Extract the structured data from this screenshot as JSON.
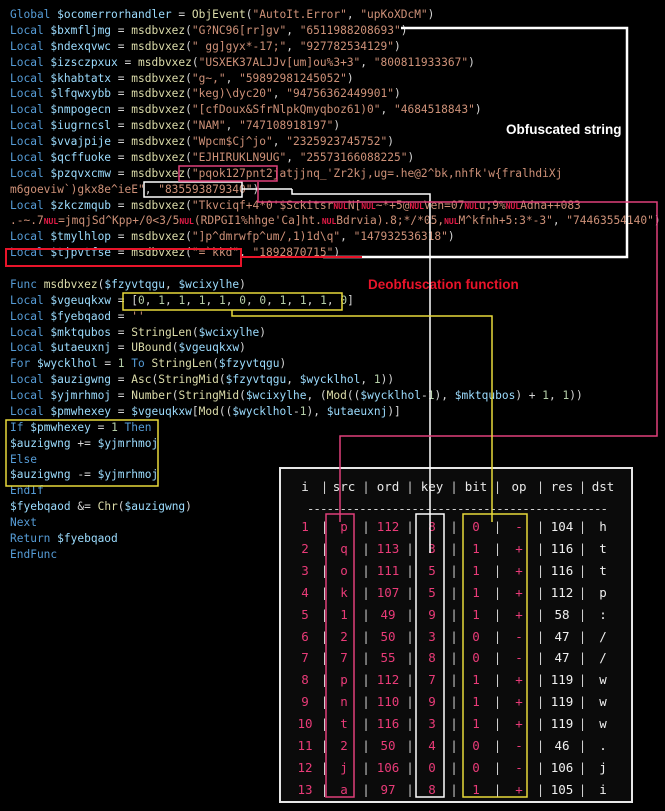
{
  "code_lines": [
    [
      [
        "Global ",
        "kw"
      ],
      [
        "$ocomerrorhandler",
        "vr"
      ],
      [
        " = ",
        "op"
      ],
      [
        "ObjEvent",
        "fn"
      ],
      [
        "(",
        "op"
      ],
      [
        "\"AutoIt.Error\"",
        "st"
      ],
      [
        ", ",
        "op"
      ],
      [
        "\"upKoXDcM\"",
        "st"
      ],
      [
        ")",
        "op"
      ]
    ],
    [
      [
        "Local ",
        "kw"
      ],
      [
        "$bxmfljmg",
        "vr"
      ],
      [
        " = ",
        "op"
      ],
      [
        "msdbvxez",
        "fn"
      ],
      [
        "(",
        "op"
      ],
      [
        "\"G?NC96[rr]gv\"",
        "st"
      ],
      [
        ", ",
        "op"
      ],
      [
        "\"6511988208693\"",
        "st"
      ],
      [
        ")",
        "op"
      ]
    ],
    [
      [
        "Local ",
        "kw"
      ],
      [
        "$ndexqvwc",
        "vr"
      ],
      [
        " = ",
        "op"
      ],
      [
        "msdbvxez",
        "fn"
      ],
      [
        "(",
        "op"
      ],
      [
        "\" gg]gyx*-17;\"",
        "st"
      ],
      [
        ", ",
        "op"
      ],
      [
        "\"927782534129\"",
        "st"
      ],
      [
        ")",
        "op"
      ]
    ],
    [
      [
        "Local ",
        "kw"
      ],
      [
        "$izsczpxux",
        "vr"
      ],
      [
        " = ",
        "op"
      ],
      [
        "msdbvxez",
        "fn"
      ],
      [
        "(",
        "op"
      ],
      [
        "\"USXEK37ALJJv[um]ou%3+3\"",
        "st"
      ],
      [
        ", ",
        "op"
      ],
      [
        "\"800811933367\"",
        "st"
      ],
      [
        ")",
        "op"
      ]
    ],
    [
      [
        "Local ",
        "kw"
      ],
      [
        "$khabtatx",
        "vr"
      ],
      [
        " = ",
        "op"
      ],
      [
        "msdbvxez",
        "fn"
      ],
      [
        "(",
        "op"
      ],
      [
        "\"g~,\"",
        "st"
      ],
      [
        ", ",
        "op"
      ],
      [
        "\"59892981245052\"",
        "st"
      ],
      [
        ")",
        "op"
      ]
    ],
    [
      [
        "Local ",
        "kw"
      ],
      [
        "$lfqwxybb",
        "vr"
      ],
      [
        " = ",
        "op"
      ],
      [
        "msdbvxez",
        "fn"
      ],
      [
        "(",
        "op"
      ],
      [
        "\"keg)\\dyc20\"",
        "st"
      ],
      [
        ", ",
        "op"
      ],
      [
        "\"94756362449901\"",
        "st"
      ],
      [
        ")",
        "op"
      ]
    ],
    [
      [
        "Local ",
        "kw"
      ],
      [
        "$nmpogecn",
        "vr"
      ],
      [
        " = ",
        "op"
      ],
      [
        "msdbvxez",
        "fn"
      ],
      [
        "(",
        "op"
      ],
      [
        "\"[cfDoux&SfrNlpkQmyqboz61)0\"",
        "st"
      ],
      [
        ", ",
        "op"
      ],
      [
        "\"4684518843\"",
        "st"
      ],
      [
        ")",
        "op"
      ]
    ],
    [
      [
        "Local ",
        "kw"
      ],
      [
        "$iugrncsl",
        "vr"
      ],
      [
        " = ",
        "op"
      ],
      [
        "msdbvxez",
        "fn"
      ],
      [
        "(",
        "op"
      ],
      [
        "\"NAM\"",
        "st"
      ],
      [
        ", ",
        "op"
      ],
      [
        "\"747108918197\"",
        "st"
      ],
      [
        ")",
        "op"
      ]
    ],
    [
      [
        "Local ",
        "kw"
      ],
      [
        "$vvajpije",
        "vr"
      ],
      [
        " = ",
        "op"
      ],
      [
        "msdbvxez",
        "fn"
      ],
      [
        "(",
        "op"
      ],
      [
        "\"Wpcm$Cj^jo\"",
        "st"
      ],
      [
        ", ",
        "op"
      ],
      [
        "\"2325923745752\"",
        "st"
      ],
      [
        ")",
        "op"
      ]
    ],
    [
      [
        "Local ",
        "kw"
      ],
      [
        "$qcffuoke",
        "vr"
      ],
      [
        " = ",
        "op"
      ],
      [
        "msdbvxez",
        "fn"
      ],
      [
        "(",
        "op"
      ],
      [
        "\"EJHIRUKLN9UG\"",
        "st"
      ],
      [
        ", ",
        "op"
      ],
      [
        "\"25573166088225\"",
        "st"
      ],
      [
        ")",
        "op"
      ]
    ],
    [
      [
        "Local ",
        "kw"
      ],
      [
        "$pzqvxcmw",
        "vr"
      ],
      [
        " = ",
        "op"
      ],
      [
        "msdbvxez",
        "fn"
      ],
      [
        "(",
        "op"
      ],
      [
        "\"pqok127pnt2ja",
        "st"
      ],
      [
        "tjjnq_'Zr2kj,ug=.he@2^bk,nhfk'w{fralhdiXj",
        "st"
      ]
    ],
    [
      [
        "m6goeviw`)gkx8e^ieE\"",
        "st"
      ],
      [
        ", ",
        "op"
      ],
      [
        "\"835593879340\"",
        "st"
      ],
      [
        ")",
        "op"
      ]
    ],
    [
      [
        "Local ",
        "kw"
      ],
      [
        "$zkczmqub",
        "vr"
      ],
      [
        " = ",
        "op"
      ],
      [
        "msdbvxez",
        "fn"
      ],
      [
        "(",
        "op"
      ],
      [
        "\"Tkvciqf+4*0'$Sckitsr",
        "st"
      ],
      [
        "NUL",
        "nb"
      ],
      [
        "N[",
        "st"
      ],
      [
        "NUL",
        "nb"
      ],
      [
        "~*+5@",
        "st"
      ],
      [
        "NUL",
        "nb"
      ],
      [
        "Ven=07",
        "st"
      ],
      [
        "NUL",
        "nb"
      ],
      [
        "u;9%",
        "st"
      ],
      [
        "NUL",
        "nb"
      ],
      [
        "Adna++083",
        "st"
      ]
    ],
    [
      [
        ".-~.7",
        "st"
      ],
      [
        "NUL",
        "nb"
      ],
      [
        "=jmqjSd^Kpp+/0<3/5",
        "st"
      ],
      [
        "NUL",
        "nb"
      ],
      [
        "(RDPGI1%hhge'Ca]ht.",
        "st"
      ],
      [
        "NUL",
        "nb"
      ],
      [
        "Bdrvia).8;*/*05,",
        "st"
      ],
      [
        "NUL",
        "nb"
      ],
      [
        "M^kfnh+5:3*-3\"",
        "st"
      ],
      [
        ", ",
        "op"
      ],
      [
        "\"74463554140\"",
        "st"
      ],
      [
        ")",
        "op"
      ]
    ],
    [
      [
        "Local ",
        "kw"
      ],
      [
        "$tmylhlop",
        "vr"
      ],
      [
        " = ",
        "op"
      ],
      [
        "msdbvxez",
        "fn"
      ],
      [
        "(",
        "op"
      ],
      [
        "\"]p^dmrwfp^um/,1)1d\\q\"",
        "st"
      ],
      [
        ", ",
        "op"
      ],
      [
        "\"147932536318\"",
        "st"
      ],
      [
        ")",
        "op"
      ]
    ],
    [
      [
        "Local ",
        "kw"
      ],
      [
        "$tjpvtfse",
        "vr"
      ],
      [
        " = ",
        "op"
      ],
      [
        "msdbvxez",
        "fn"
      ],
      [
        "(",
        "op"
      ],
      [
        "\"=`kkd\"",
        "st"
      ],
      [
        ", ",
        "op"
      ],
      [
        "\"1892870715\"",
        "st"
      ],
      [
        ")",
        "op"
      ]
    ],
    [],
    [
      [
        "Func ",
        "kw"
      ],
      [
        "msdbvxez",
        "fn"
      ],
      [
        "(",
        "op"
      ],
      [
        "$fzyvtqgu",
        "vr"
      ],
      [
        ", ",
        "op"
      ],
      [
        "$wcixylhe",
        "vr"
      ],
      [
        ")",
        "op"
      ]
    ],
    [
      [
        "Local ",
        "kw"
      ],
      [
        "$vgeuqkxw",
        "vr"
      ],
      [
        " = ",
        "op"
      ],
      [
        "[",
        "op"
      ],
      [
        "0",
        "nm"
      ],
      [
        ", ",
        "op"
      ],
      [
        "1",
        "nm"
      ],
      [
        ", ",
        "op"
      ],
      [
        "1",
        "nm"
      ],
      [
        ", ",
        "op"
      ],
      [
        "1",
        "nm"
      ],
      [
        ", ",
        "op"
      ],
      [
        "1",
        "nm"
      ],
      [
        ", ",
        "op"
      ],
      [
        "0",
        "nm"
      ],
      [
        ", ",
        "op"
      ],
      [
        "0",
        "nm"
      ],
      [
        ", ",
        "op"
      ],
      [
        "1",
        "nm"
      ],
      [
        ", ",
        "op"
      ],
      [
        "1",
        "nm"
      ],
      [
        ", ",
        "op"
      ],
      [
        "1",
        "nm"
      ],
      [
        ", ",
        "op"
      ],
      [
        "0",
        "nm"
      ],
      [
        "]",
        "op"
      ]
    ],
    [
      [
        "Local ",
        "kw"
      ],
      [
        "$fyebqaod",
        "vr"
      ],
      [
        " = ",
        "op"
      ],
      [
        "''",
        "st"
      ]
    ],
    [
      [
        "Local ",
        "kw"
      ],
      [
        "$mktqubos",
        "vr"
      ],
      [
        " = ",
        "op"
      ],
      [
        "StringLen",
        "fn"
      ],
      [
        "(",
        "op"
      ],
      [
        "$wcixylhe",
        "vr"
      ],
      [
        ")",
        "op"
      ]
    ],
    [
      [
        "Local ",
        "kw"
      ],
      [
        "$utaeuxnj",
        "vr"
      ],
      [
        " = ",
        "op"
      ],
      [
        "UBound",
        "fn"
      ],
      [
        "(",
        "op"
      ],
      [
        "$vgeuqkxw",
        "vr"
      ],
      [
        ")",
        "op"
      ]
    ],
    [
      [
        "For ",
        "kw"
      ],
      [
        "$wycklhol",
        "vr"
      ],
      [
        " = ",
        "op"
      ],
      [
        "1",
        "nm"
      ],
      [
        " To ",
        "kw"
      ],
      [
        "StringLen",
        "fn"
      ],
      [
        "(",
        "op"
      ],
      [
        "$fzyvtqgu",
        "vr"
      ],
      [
        ")",
        "op"
      ]
    ],
    [
      [
        "Local ",
        "kw"
      ],
      [
        "$auzigwng",
        "vr"
      ],
      [
        " = ",
        "op"
      ],
      [
        "Asc",
        "fn"
      ],
      [
        "(",
        "op"
      ],
      [
        "StringMid",
        "fn"
      ],
      [
        "(",
        "op"
      ],
      [
        "$fzyvtqgu",
        "vr"
      ],
      [
        ", ",
        "op"
      ],
      [
        "$wycklhol",
        "vr"
      ],
      [
        ", ",
        "op"
      ],
      [
        "1",
        "nm"
      ],
      [
        "))",
        "op"
      ]
    ],
    [
      [
        "Local ",
        "kw"
      ],
      [
        "$yjmrhmoj",
        "vr"
      ],
      [
        " = ",
        "op"
      ],
      [
        "Number",
        "fn"
      ],
      [
        "(",
        "op"
      ],
      [
        "StringMid",
        "fn"
      ],
      [
        "(",
        "op"
      ],
      [
        "$wcixylhe",
        "vr"
      ],
      [
        ", (",
        "op"
      ],
      [
        "Mod",
        "fn"
      ],
      [
        "((",
        "op"
      ],
      [
        "$wycklhol",
        "vr"
      ],
      [
        "-",
        "op"
      ],
      [
        "1",
        "nm"
      ],
      [
        "), ",
        "op"
      ],
      [
        "$mktqubos",
        "vr"
      ],
      [
        ") + ",
        "op"
      ],
      [
        "1",
        "nm"
      ],
      [
        ", ",
        "op"
      ],
      [
        "1",
        "nm"
      ],
      [
        "))",
        "op"
      ]
    ],
    [
      [
        "Local ",
        "kw"
      ],
      [
        "$pmwhexey",
        "vr"
      ],
      [
        " = ",
        "op"
      ],
      [
        "$vgeuqkxw",
        "vr"
      ],
      [
        "[",
        "op"
      ],
      [
        "Mod",
        "fn"
      ],
      [
        "((",
        "op"
      ],
      [
        "$wycklhol",
        "vr"
      ],
      [
        "-",
        "op"
      ],
      [
        "1",
        "nm"
      ],
      [
        "), ",
        "op"
      ],
      [
        "$utaeuxnj",
        "vr"
      ],
      [
        ")]",
        "op"
      ]
    ],
    [
      [
        "If ",
        "kw"
      ],
      [
        "$pmwhexey",
        "vr"
      ],
      [
        " = ",
        "op"
      ],
      [
        "1",
        "nm"
      ],
      [
        " Then",
        "kw"
      ]
    ],
    [
      [
        "$auzigwng",
        "vr"
      ],
      [
        " += ",
        "op"
      ],
      [
        "$yjmrhmoj",
        "vr"
      ]
    ],
    [
      [
        "Else",
        "kw"
      ]
    ],
    [
      [
        "$auzigwng",
        "vr"
      ],
      [
        " -= ",
        "op"
      ],
      [
        "$yjmrhmoj",
        "vr"
      ]
    ],
    [
      [
        "EndIf",
        "kw"
      ]
    ],
    [
      [
        "$fyebqaod",
        "vr"
      ],
      [
        " &= ",
        "op"
      ],
      [
        "Chr",
        "fn"
      ],
      [
        "(",
        "op"
      ],
      [
        "$auzigwng",
        "vr"
      ],
      [
        ")",
        "op"
      ]
    ],
    [
      [
        "Next",
        "kw"
      ]
    ],
    [
      [
        "Return ",
        "kw"
      ],
      [
        "$fyebqaod",
        "vr"
      ]
    ],
    [
      [
        "EndFunc",
        "kw"
      ]
    ]
  ],
  "annotations": {
    "obfuscated_string": "Obfuscated string",
    "deobfuscation_function": "Deobfuscation function"
  },
  "table": {
    "headers": [
      "i",
      "src",
      "ord",
      "key",
      "bit",
      "op",
      "res",
      "dst"
    ],
    "separator": "----------------------------------------------",
    "rows": [
      [
        "1",
        "p",
        "112",
        "8",
        "0",
        "-",
        "104",
        "h"
      ],
      [
        "2",
        "q",
        "113",
        "3",
        "1",
        "+",
        "116",
        "t"
      ],
      [
        "3",
        "o",
        "111",
        "5",
        "1",
        "+",
        "116",
        "t"
      ],
      [
        "4",
        "k",
        "107",
        "5",
        "1",
        "+",
        "112",
        "p"
      ],
      [
        "5",
        "1",
        "49",
        "9",
        "1",
        "+",
        "58",
        ":"
      ],
      [
        "6",
        "2",
        "50",
        "3",
        "0",
        "-",
        "47",
        "/"
      ],
      [
        "7",
        "7",
        "55",
        "8",
        "0",
        "-",
        "47",
        "/"
      ],
      [
        "8",
        "p",
        "112",
        "7",
        "1",
        "+",
        "119",
        "w"
      ],
      [
        "9",
        "n",
        "110",
        "9",
        "1",
        "+",
        "119",
        "w"
      ],
      [
        "10",
        "t",
        "116",
        "3",
        "1",
        "+",
        "119",
        "w"
      ],
      [
        "11",
        "2",
        "50",
        "4",
        "0",
        "-",
        "46",
        "."
      ],
      [
        "12",
        "j",
        "106",
        "0",
        "0",
        "-",
        "106",
        "j"
      ],
      [
        "13",
        "a",
        "97",
        "8",
        "1",
        "+",
        "105",
        "i"
      ]
    ]
  },
  "colors": {
    "background": "#000000",
    "keyword": "#569cd6",
    "variable": "#9cdcfe",
    "function": "#dcdcaa",
    "string": "#ce9178",
    "number": "#b5cea8",
    "highlight_red": "#e8142a",
    "highlight_pink": "#e0407a",
    "highlight_yellow": "#e8d93a",
    "highlight_white": "#ffffff"
  }
}
